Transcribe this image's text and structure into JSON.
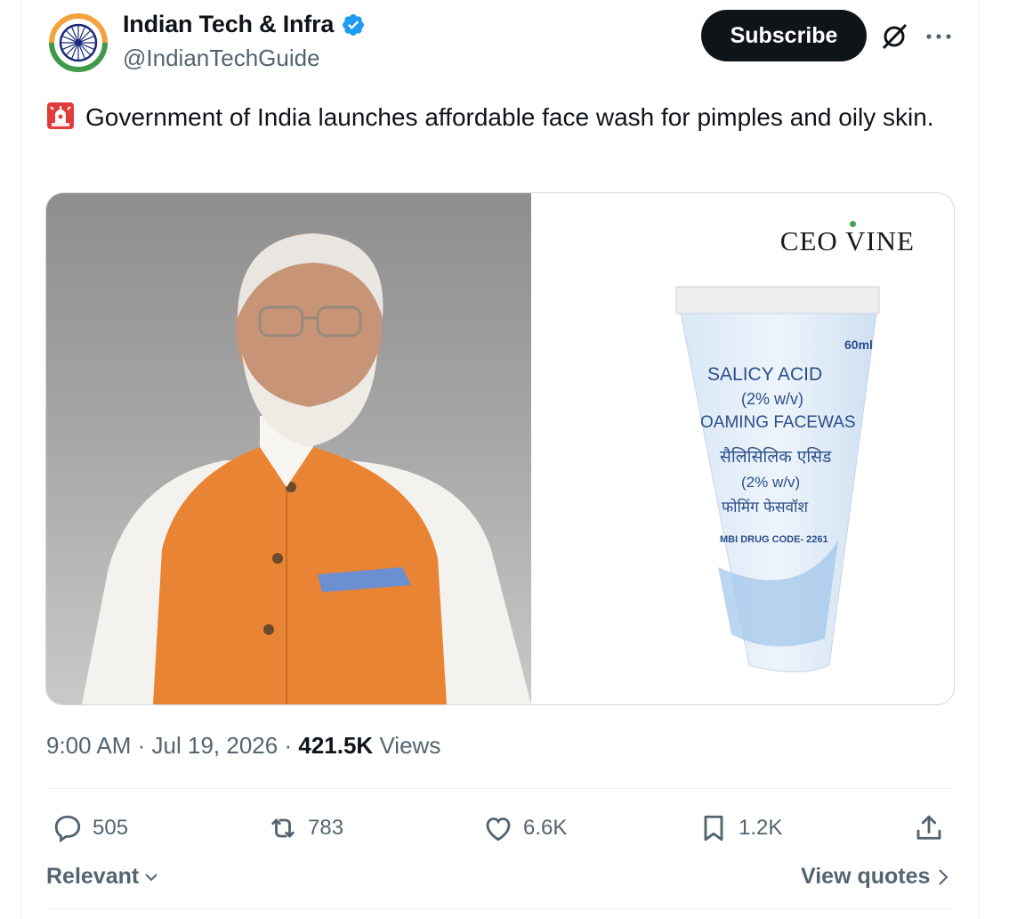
{
  "author": {
    "display_name": "Indian Tech & Infra",
    "handle": "@IndianTechGuide",
    "avatar_icon": "ashoka-chakra-avatar",
    "verified_icon": "verified-badge-icon",
    "verified_color": "#1d9bf0"
  },
  "header": {
    "subscribe_label": "Subscribe",
    "grok_icon": "grok-icon",
    "more_icon": "more-icon"
  },
  "tweet": {
    "emoji": "siren-icon",
    "text": "Government of India launches affordable face wash for pimples and oily skin."
  },
  "media": {
    "brand": "CEO VINE",
    "tube_lines": {
      "size": "60ml",
      "line1": "SALICY   ACID",
      "line2": "(2% w/v)",
      "line3": "OAMING FACEWAS",
      "line4": "सैलिसिलिक एसिड",
      "line5": "(2% w/v)",
      "line6": "फोमिंग फेसवॉश",
      "line7": "MBI DRUG CODE- 2261"
    }
  },
  "meta": {
    "time": "9:00 AM",
    "date": "Jul 19, 2026",
    "views_count": "421.5K",
    "views_label": "Views"
  },
  "actions": {
    "replies": "505",
    "reposts": "783",
    "likes": "6.6K",
    "bookmarks": "1.2K",
    "reply_icon": "reply-icon",
    "repost_icon": "repost-icon",
    "like_icon": "heart-icon",
    "bookmark_icon": "bookmark-icon",
    "share_icon": "share-icon"
  },
  "footer": {
    "sort_label": "Relevant",
    "view_quotes_label": "View quotes"
  },
  "colors": {
    "text_primary": "#0f1419",
    "text_secondary": "#536471",
    "button_dark": "#0f1419",
    "accent_blue": "#1d9bf0",
    "border": "#eff3f4"
  }
}
